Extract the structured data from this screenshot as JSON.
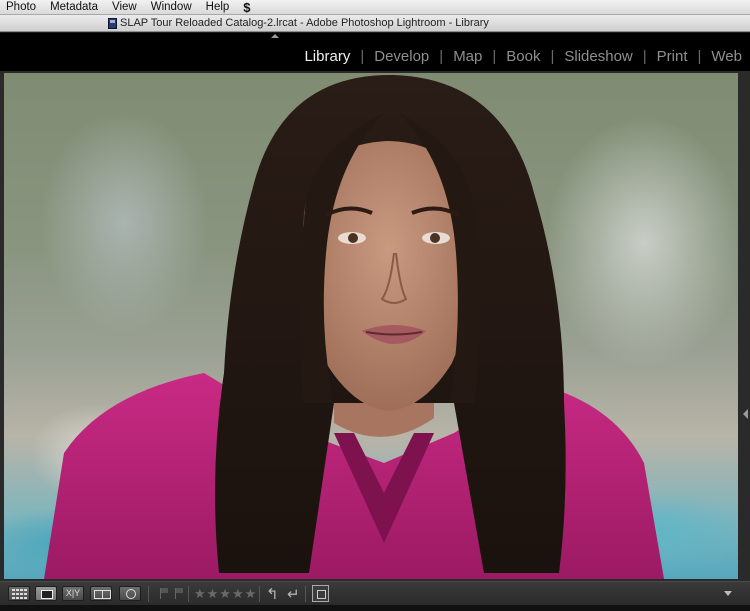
{
  "menubar": {
    "items": [
      "Photo",
      "Metadata",
      "View",
      "Window",
      "Help"
    ],
    "script_glyph": "$"
  },
  "window": {
    "title": "SLAP Tour Reloaded Catalog-2.lrcat - Adobe Photoshop Lightroom - Library"
  },
  "modules": {
    "items": [
      "Library",
      "Develop",
      "Map",
      "Book",
      "Slideshow",
      "Print",
      "Web"
    ],
    "active": "Library",
    "separator": "|"
  },
  "toolbar": {
    "compare_label": "X|Y",
    "stars": "★★★★★",
    "rotate_left": "↰",
    "rotate_right": "↵"
  },
  "colors": {
    "background": "#2a2a2a",
    "header_bg": "#000000",
    "active_module": "#f0f0f0",
    "inactive_module": "#8f8f8f",
    "shirt": "#c2267e"
  },
  "icons": {
    "grid_view": "grid-icon",
    "loupe_view": "loupe-icon",
    "compare_view": "compare-icon",
    "survey_view": "survey-icon",
    "people_view": "people-icon",
    "flag_pick": "flag-icon",
    "flag_reject": "reject-flag-icon",
    "rotate_ccw": "rotate-left-icon",
    "rotate_cw": "rotate-right-icon",
    "crop": "crop-icon"
  }
}
